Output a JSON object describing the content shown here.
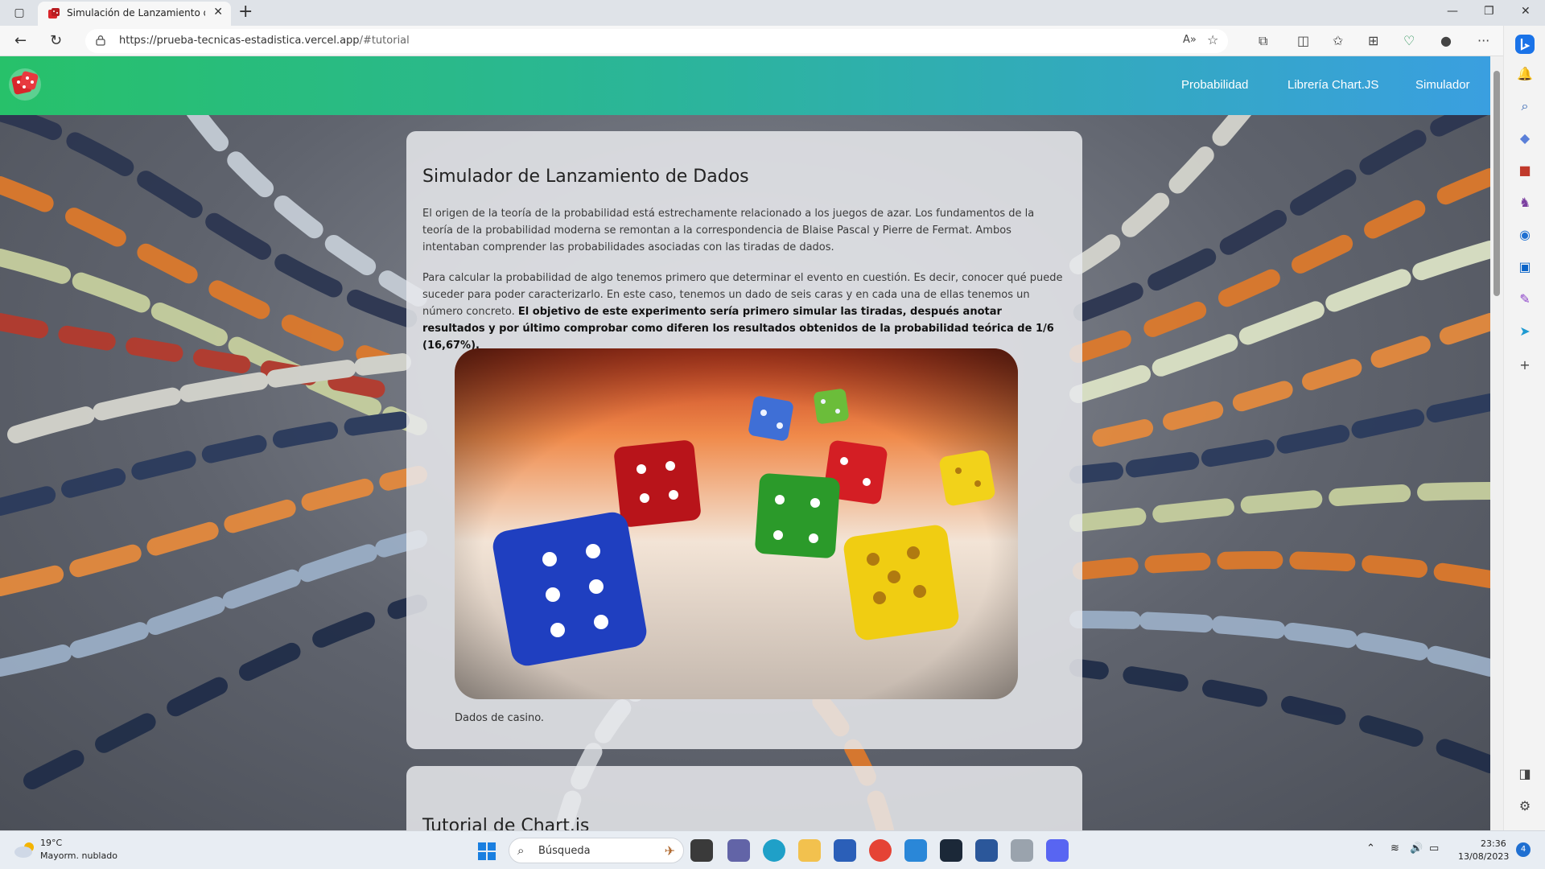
{
  "browser": {
    "tab_title": "Simulación de Lanzamiento de D",
    "url_host": "https://prueba-tecnicas-estadistica.vercel.app",
    "url_path": "/#tutorial",
    "icons": [
      "sidebar-toggle-icon",
      "close-icon",
      "plus-icon",
      "minimize-icon",
      "restore-icon",
      "back-icon",
      "refresh-icon",
      "lock-icon",
      "read-aloud-icon",
      "favorite-star-icon",
      "extensions-icon",
      "split-screen-icon",
      "favorites-icon",
      "collections-icon",
      "browser-essentials-icon",
      "profile-icon",
      "more-icon",
      "bing-copilot-icon"
    ]
  },
  "site": {
    "nav": [
      "Probabilidad",
      "Librería Chart.JS",
      "Simulador"
    ],
    "colors": {
      "header_start": "#27c16a",
      "header_end": "#3a9fe0"
    }
  },
  "article": {
    "title": "Simulador de Lanzamiento de Dados",
    "para1": "El origen de la teoría de la probabilidad está estrechamente relacionado a los juegos de azar. Los fundamentos de la teoría de la probabilidad moderna se remontan a la correspondencia de Blaise Pascal y Pierre de Fermat. Ambos intentaban comprender las probabilidades asociadas con las tiradas de dados.",
    "para2_plain": "Para calcular la probabilidad de algo tenemos primero que determinar el evento en cuestión. Es decir, conocer qué puede suceder para poder caracterizarlo. En este caso, tenemos un dado de seis caras y en cada una de ellas tenemos un número concreto. ",
    "para2_bold": "El objetivo de este experimento sería primero simular las tiradas, después anotar resultados y por último comprobar como diferen los resultados obtenidos de la probabilidad teórica de 1/6 (16,67%).",
    "caption": "Dados de casino."
  },
  "next_section": {
    "title": "Tutorial de Chart.js"
  },
  "taskbar": {
    "temp": "19°C",
    "weather": "Mayorm. nublado",
    "search_placeholder": "Búsqueda",
    "time": "23:36",
    "date": "13/08/2023",
    "notifications": "4"
  }
}
